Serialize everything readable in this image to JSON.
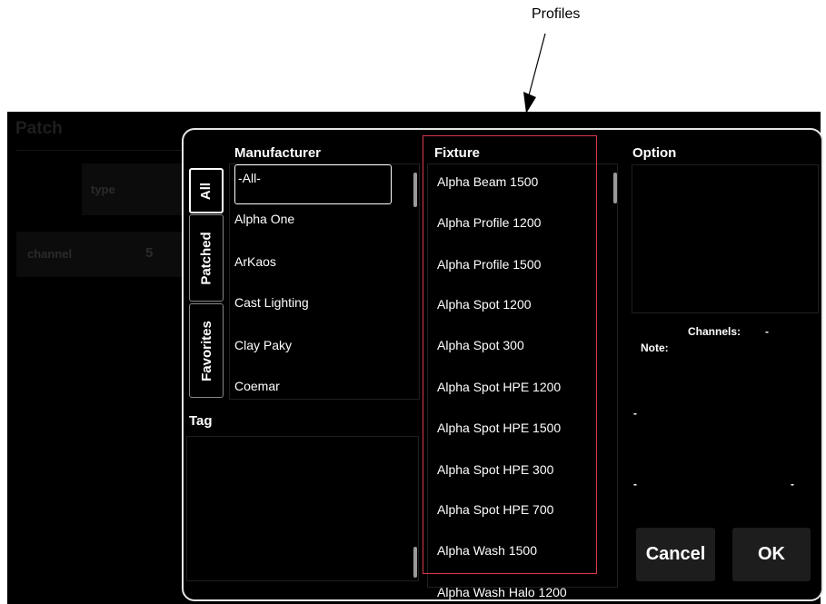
{
  "callout": {
    "label": "Profiles"
  },
  "background": {
    "title": "Patch",
    "type_label": "type",
    "channel_label": "channel",
    "channel_value": "5"
  },
  "dialog": {
    "tabs": [
      {
        "label": "All",
        "active": true
      },
      {
        "label": "Patched",
        "active": false
      },
      {
        "label": "Favorites",
        "active": false
      }
    ],
    "manufacturer": {
      "header": "Manufacturer",
      "selected": "-All-",
      "items": [
        "-All-",
        "Alpha One",
        "ArKaos",
        "Cast Lighting",
        "Clay Paky",
        "Coemar"
      ]
    },
    "tag": {
      "header": "Tag"
    },
    "fixture": {
      "header": "Fixture",
      "items": [
        "Alpha Beam 1500",
        "Alpha Profile 1200",
        "Alpha Profile 1500",
        "Alpha Spot 1200",
        "Alpha Spot 300",
        "Alpha Spot HPE 1200",
        "Alpha Spot HPE 1500",
        "Alpha Spot HPE 300",
        "Alpha Spot HPE 700",
        "Alpha Wash 1500",
        "Alpha Wash Halo 1200"
      ]
    },
    "option": {
      "header": "Option",
      "channels_label": "Channels:",
      "channels_value": "-",
      "note_label": "Note:",
      "dash1": "-",
      "dash2": "-",
      "dash3": "-"
    },
    "buttons": {
      "cancel": "Cancel",
      "ok": "OK"
    }
  },
  "colors": {
    "highlight_frame": "#d83a4a",
    "dialog_border": "#e6e6e6",
    "button_bg": "#1d1d1d"
  }
}
